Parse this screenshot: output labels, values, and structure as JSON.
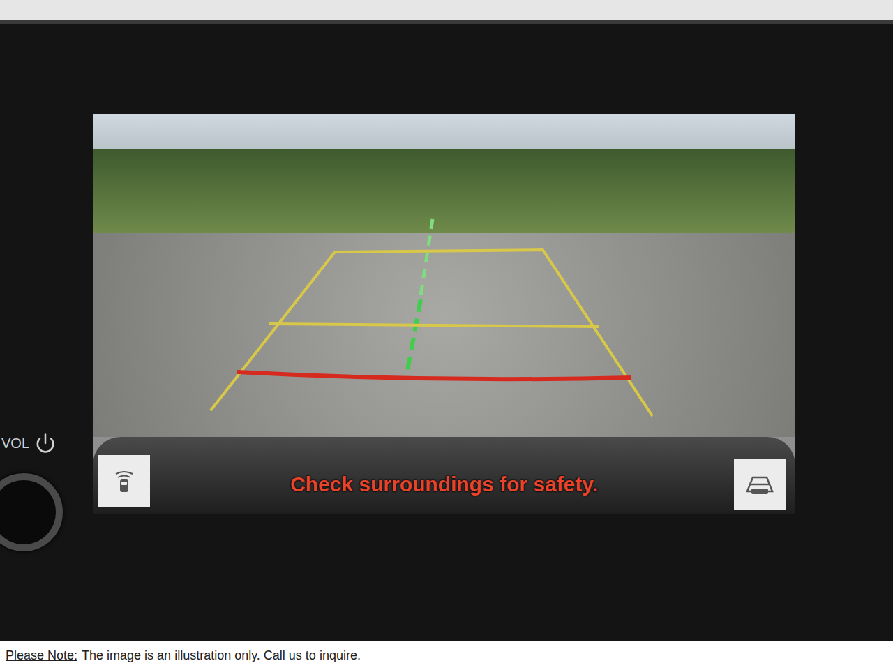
{
  "device": {
    "volume_label": "VOL"
  },
  "camera": {
    "message": "Check surroundings for safety."
  },
  "caption": {
    "label": "Please Note:",
    "text": "The image is an illustration only. Call us to inquire."
  }
}
